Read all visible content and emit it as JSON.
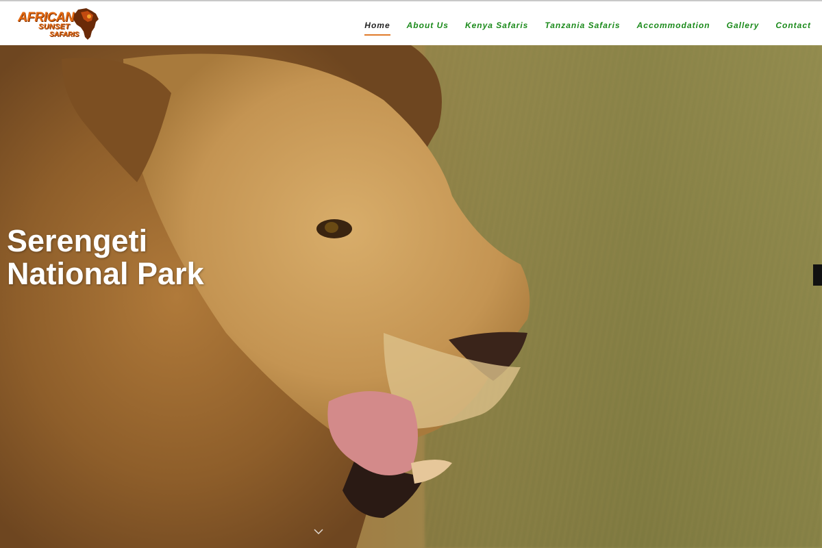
{
  "logo": {
    "line1": "AFRICAN",
    "line2": "SUNSET",
    "line3": "SAFARIS",
    "brand_color": "#e46a12"
  },
  "nav": {
    "items": [
      {
        "label": "Home",
        "active": true
      },
      {
        "label": "About Us",
        "active": false
      },
      {
        "label": "Kenya Safaris",
        "active": false
      },
      {
        "label": "Tanzania Safaris",
        "active": false
      },
      {
        "label": "Accommodation",
        "active": false
      },
      {
        "label": "Gallery",
        "active": false
      },
      {
        "label": "Contact",
        "active": false
      }
    ],
    "link_color": "#1a8a1a",
    "active_underline_color": "#e07a2a"
  },
  "hero": {
    "title_line1": "Serengeti",
    "title_line2": "National Park",
    "scroll_icon": "chevron-down-icon"
  }
}
